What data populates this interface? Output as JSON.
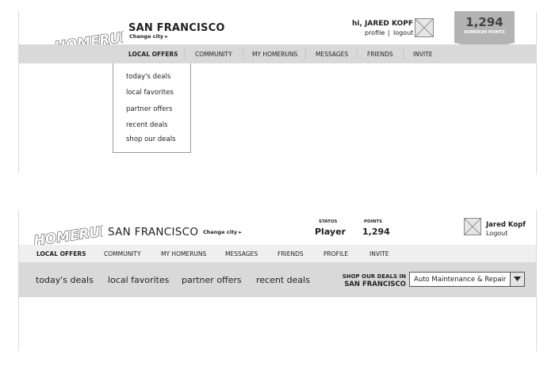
{
  "top_wireframe": {
    "header": {
      "city": "SAN FRANCISCO",
      "change_city": "Change city ▸",
      "greeting": "hi, JARED KOPF",
      "profile_link": "profile",
      "separator": "|",
      "logout_link": "logout"
    },
    "points": {
      "value": "1,294",
      "label": "HOMERUN POINTS"
    },
    "nav": [
      "LOCAL OFFERS",
      "COMMUNITY",
      "MY HOMERUNS",
      "MESSAGES",
      "FRIENDS",
      "INVITE"
    ],
    "dropdown": [
      "today's deals",
      "local favorites",
      "partner offers",
      "recent deals",
      "shop our deals"
    ]
  },
  "bottom_wireframe": {
    "header": {
      "city": "SAN FRANCISCO",
      "change_city": "Change city ▸",
      "status_label": "STATUS",
      "status_value": "Player",
      "points_label": "POINTS",
      "points_value": "1,294",
      "user_name": "Jared Kopf",
      "logout": "Logout"
    },
    "nav": [
      "LOCAL OFFERS",
      "COMMUNITY",
      "MY HOMERUNS",
      "MESSAGES",
      "FRIENDS",
      "PROFILE",
      "INVITE"
    ],
    "subnav": [
      "today's deals",
      "local favorites",
      "partner offers",
      "recent deals"
    ],
    "shop": {
      "label": "SHOP OUR DEALS IN",
      "city": "SAN FRANCISCO",
      "selected": "Auto Maintenance & Repair"
    }
  },
  "logo_alt": "HOMERUN",
  "colors": {
    "nav_bar": "#d9d9d9",
    "points_badge": "#b3b3b3",
    "border": "#999999"
  }
}
